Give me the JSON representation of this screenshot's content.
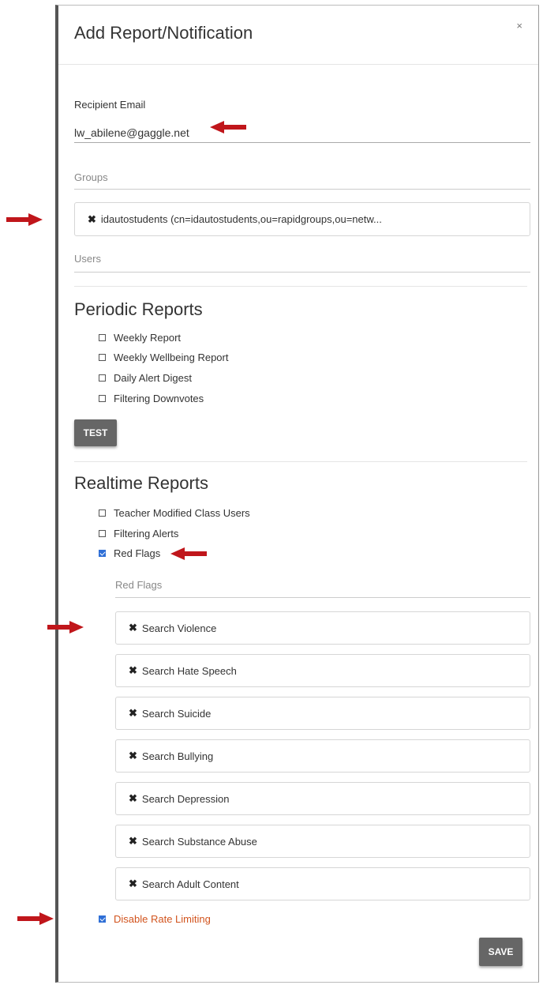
{
  "modal": {
    "title": "Add Report/Notification",
    "close_symbol": "×"
  },
  "recipient": {
    "label": "Recipient Email",
    "value": "lw_abilene@gaggle.net"
  },
  "groups": {
    "label": "Groups",
    "chips": [
      "idautostudents (cn=idautostudents,ou=rapidgroups,ou=netw..."
    ]
  },
  "users": {
    "label": "Users"
  },
  "periodic": {
    "heading": "Periodic Reports",
    "options": [
      {
        "label": "Weekly Report",
        "checked": false
      },
      {
        "label": "Weekly Wellbeing Report",
        "checked": false
      },
      {
        "label": "Daily Alert Digest",
        "checked": false
      },
      {
        "label": "Filtering Downvotes",
        "checked": false
      }
    ],
    "test_label": "TEST"
  },
  "realtime": {
    "heading": "Realtime Reports",
    "options": [
      {
        "label": "Teacher Modified Class Users",
        "checked": false
      },
      {
        "label": "Filtering Alerts",
        "checked": false
      },
      {
        "label": "Red Flags",
        "checked": true
      }
    ],
    "red_flags_label": "Red Flags",
    "red_flags": [
      "Search Violence",
      "Search Hate Speech",
      "Search Suicide",
      "Search Bullying",
      "Search Depression",
      "Search Substance Abuse",
      "Search Adult Content"
    ]
  },
  "rate_limit": {
    "label": "Disable Rate Limiting",
    "checked": true
  },
  "save_label": "SAVE",
  "colors": {
    "accent_checkbox": "#2f6fd6",
    "warning_text": "#d2541e",
    "annotation_arrow": "#c0161b",
    "button": "#666666"
  }
}
